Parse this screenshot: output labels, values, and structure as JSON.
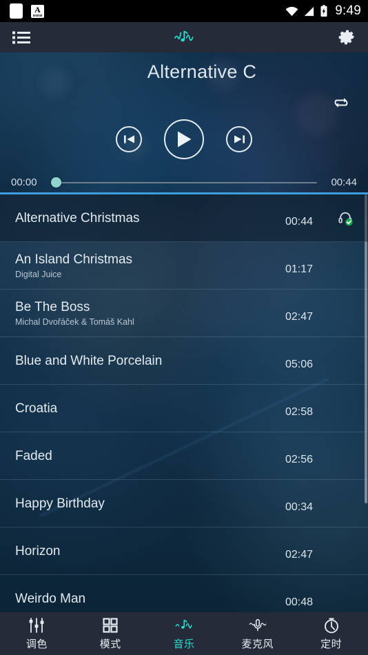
{
  "statusbar": {
    "icons": [
      "app-square-icon",
      "keyboard-a-icon",
      "wifi-icon",
      "signal-icon",
      "battery-charging-icon"
    ],
    "time": "9:49"
  },
  "appbar": {
    "list_icon": "playlist-icon",
    "logo_icon": "music-wave-icon",
    "settings_icon": "gear-icon"
  },
  "player": {
    "title": "Alternative C",
    "repeat_icon": "repeat-icon",
    "prev_label": "prev-track",
    "play_label": "play",
    "next_label": "next-track",
    "elapsed": "00:00",
    "duration": "00:44",
    "progress_percent": 0,
    "accent_color": "#3e9ede",
    "thumb_color": "#8fd4cd"
  },
  "playlist": {
    "tracks": [
      {
        "title": "Alternative Christmas",
        "artist": "",
        "duration": "00:44",
        "playing": true
      },
      {
        "title": "An Island Christmas",
        "artist": "Digital Juice",
        "duration": "01:17",
        "playing": false
      },
      {
        "title": "Be The Boss",
        "artist": "Michal Dvořáček & Tomáš Kahl",
        "duration": "02:47",
        "playing": false
      },
      {
        "title": "Blue and White Porcelain",
        "artist": "",
        "duration": "05:06",
        "playing": false
      },
      {
        "title": "Croatia",
        "artist": "",
        "duration": "02:58",
        "playing": false
      },
      {
        "title": "Faded",
        "artist": "",
        "duration": "02:56",
        "playing": false
      },
      {
        "title": "Happy Birthday",
        "artist": "",
        "duration": "00:34",
        "playing": false
      },
      {
        "title": "Horizon",
        "artist": "",
        "duration": "02:47",
        "playing": false
      },
      {
        "title": "Weirdo Man",
        "artist": "",
        "duration": "00:48",
        "playing": false
      }
    ],
    "playing_badge_icon": "headphone-check-icon"
  },
  "bottomnav": {
    "active_color": "#25e0d0",
    "items": [
      {
        "label": "调色",
        "icon": "sliders-icon",
        "active": false
      },
      {
        "label": "模式",
        "icon": "grid-icon",
        "active": false
      },
      {
        "label": "音乐",
        "icon": "music-wave-icon",
        "active": true
      },
      {
        "label": "麦克风",
        "icon": "microphone-icon",
        "active": false
      },
      {
        "label": "定时",
        "icon": "timer-icon",
        "active": false
      }
    ]
  }
}
